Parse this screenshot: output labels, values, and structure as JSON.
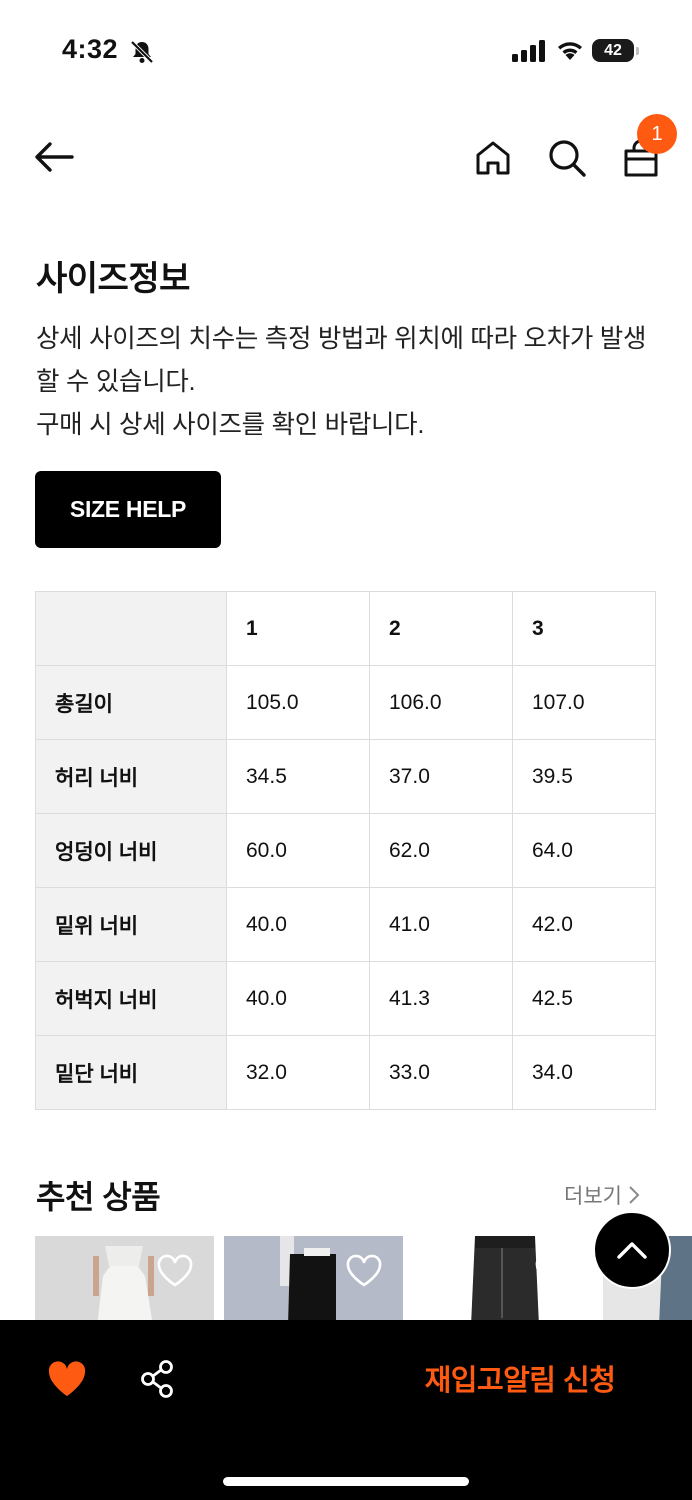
{
  "status_bar": {
    "time": "4:32",
    "battery": "42"
  },
  "header": {
    "cart_count": "1"
  },
  "size_info": {
    "title": "사이즈정보",
    "description": [
      "상세 사이즈의 치수는 측정 방법과 위치에 따라 오차가 발생할 수 있습니다.",
      "구매 시 상세 사이즈를 확인 바랍니다."
    ],
    "help_button": "SIZE HELP"
  },
  "size_table": {
    "columns": [
      "1",
      "2",
      "3"
    ],
    "rows": [
      {
        "label": "총길이",
        "values": [
          "105.0",
          "106.0",
          "107.0"
        ]
      },
      {
        "label": "허리 너비",
        "values": [
          "34.5",
          "37.0",
          "39.5"
        ]
      },
      {
        "label": "엉덩이 너비",
        "values": [
          "60.0",
          "62.0",
          "64.0"
        ]
      },
      {
        "label": "밑위 너비",
        "values": [
          "40.0",
          "41.0",
          "42.0"
        ]
      },
      {
        "label": "허벅지 너비",
        "values": [
          "40.0",
          "41.3",
          "42.5"
        ]
      },
      {
        "label": "밑단 너비",
        "values": [
          "32.0",
          "33.0",
          "34.0"
        ]
      }
    ]
  },
  "recommended": {
    "title": "추천 상품",
    "more_label": "더보기"
  },
  "bottom_bar": {
    "restock_label": "재입고알림 신청"
  },
  "colors": {
    "accent": "#ff5a12",
    "black": "#000000",
    "table_header_bg": "#f2f2f2"
  }
}
